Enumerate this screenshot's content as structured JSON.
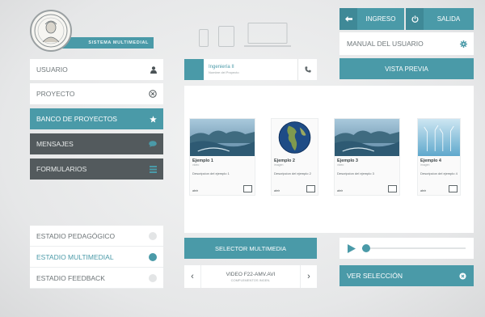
{
  "logo": {
    "banner": "SISTEMA MULTIMEDIAL"
  },
  "header": {
    "ingreso_label": "INGRESO",
    "salida_label": "SALIDA",
    "manual_label": "MANUAL DEL USUARIO",
    "vista_previa_label": "VISTA PREVIA"
  },
  "sidebar": {
    "items": [
      {
        "label": "USUARIO",
        "icon": "user-icon",
        "style": "white"
      },
      {
        "label": "PROYECTO",
        "icon": "close-circle-icon",
        "style": "white"
      },
      {
        "label": "BANCO DE PROYECTOS",
        "icon": "star-icon",
        "style": "teal"
      },
      {
        "label": "MENSAJES",
        "icon": "chat-icon",
        "style": "dark"
      },
      {
        "label": "FORMULARIOS",
        "icon": "list-icon",
        "style": "dark"
      }
    ]
  },
  "project": {
    "title": "Ingeniería II",
    "subtitle": "Nombre del Proyecto"
  },
  "cards": [
    {
      "title": "Ejemplo 1",
      "subtitle": "video",
      "desc": "Descripcion del ejemplo 1",
      "action": "abrir",
      "thumb": "wave"
    },
    {
      "title": "Ejemplo 2",
      "subtitle": "imagen",
      "desc": "Descripcion del ejemplo 2",
      "action": "abrir",
      "thumb": "globe"
    },
    {
      "title": "Ejemplo 3",
      "subtitle": "video",
      "desc": "Descripcion del ejemplo 3",
      "action": "abrir",
      "thumb": "wave"
    },
    {
      "title": "Ejemplo 4",
      "subtitle": "imagen",
      "desc": "Descripcion del ejemplo 4",
      "action": "abrir",
      "thumb": "wind"
    }
  ],
  "estados": [
    {
      "label": "ESTADIO PEDAGÓGICO",
      "active": false
    },
    {
      "label": "ESTADIO MULTIMEDIAL",
      "active": true
    },
    {
      "label": "ESTADIO FEEDBACK",
      "active": false
    }
  ],
  "media": {
    "selector_label": "SELECTOR MULTIMEDIA",
    "video_name": "VIDEO F22-AMV.AVI",
    "video_sub": "COMPLEMENTOS INGEN.",
    "progress": 0.04,
    "ver_seleccion_label": "VER SELECCIÓN"
  },
  "colors": {
    "accent": "#4a9aa8",
    "dark": "#535a5d",
    "panel": "#ffffff"
  }
}
